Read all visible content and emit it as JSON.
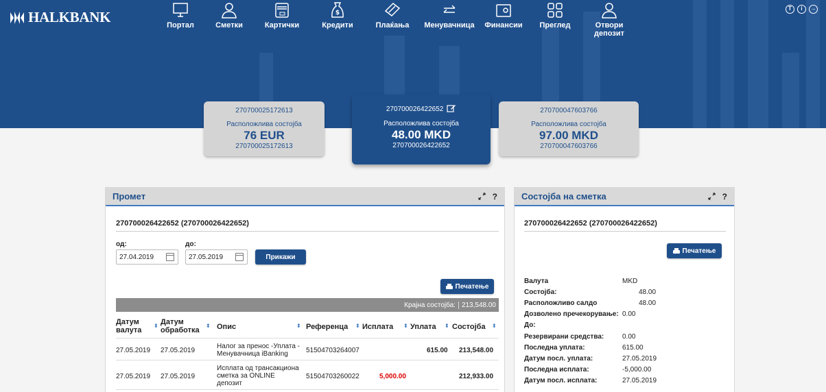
{
  "brand": {
    "name": "HALKBANK"
  },
  "nav": [
    {
      "label": "Портал",
      "icon": "monitor-icon"
    },
    {
      "label": "Сметки",
      "icon": "user-icon"
    },
    {
      "label": "Картички",
      "icon": "card-icon"
    },
    {
      "label": "Кредити",
      "icon": "money-bag-icon"
    },
    {
      "label": "Плаќања",
      "icon": "payment-icon"
    },
    {
      "label": "Менувачница",
      "icon": "exchange-icon"
    },
    {
      "label": "Финансии",
      "icon": "wallet-icon"
    },
    {
      "label": "Преглед",
      "icon": "grid-icon"
    },
    {
      "label": "Отвори",
      "label2": "депозит",
      "icon": "user-deposit-icon"
    }
  ],
  "top_icons": [
    "T",
    "i",
    "→"
  ],
  "accounts": [
    {
      "number": "270700025172613",
      "label": "Расположлива состојба",
      "balance": "76 EUR",
      "number2": "270700025172613"
    },
    {
      "number": "270700026422652",
      "label": "Расположлива состојба",
      "balance": "48.00 MKD",
      "number2": "270700026422652"
    },
    {
      "number": "270700047603766",
      "label": "Расположлива состојба",
      "balance": "97.00 MKD",
      "number2": "270700047603766"
    }
  ],
  "promet": {
    "title": "Промет",
    "help": "?",
    "account": "270700026422652 (270700026422652)",
    "from_label": "од:",
    "from_value": "27.04.2019",
    "to_label": "до:",
    "to_value": "27.05.2019",
    "show_button": "Прикажи",
    "print_button": "Печатење",
    "closing_label": "Крајна состојба:",
    "closing_value": "213,548.00",
    "headers": {
      "value_date_1": "Датум",
      "value_date_2": "валута",
      "proc_date_1": "Датум",
      "proc_date_2": "обработка",
      "desc": "Опис",
      "ref": "Референца",
      "out": "Исплата",
      "in": "Уплата",
      "bal": "Состојба"
    },
    "rows": [
      {
        "value_date": "27.05.2019",
        "proc_date": "27.05.2019",
        "desc1": "Налог за пренос -Уплата -",
        "desc2": "Менувачница iBanking",
        "desc3": "",
        "ref": "51504703264007",
        "out": "",
        "in": "615.00",
        "bal": "213,548.00"
      },
      {
        "value_date": "27.05.2019",
        "proc_date": "27.05.2019",
        "desc1": "Исплата од трансакциона",
        "desc2": "сметка за ONLINE",
        "desc3": "депозит",
        "ref": "51504703260022",
        "out": "5,000.00",
        "in": "",
        "bal": "212,933.00"
      }
    ]
  },
  "status": {
    "title": "Состојба на сметка",
    "help": "?",
    "account": "270700026422652 (270700026422652)",
    "print_button": "Печатење",
    "rows": [
      {
        "k": "Валута",
        "v": "MKD"
      },
      {
        "k": "Состојба:",
        "v": "48.00"
      },
      {
        "k": "Расположливо салдо",
        "v": "48.00"
      },
      {
        "k": "Дозволено пречекорување:",
        "v": "0.00"
      },
      {
        "k": "До:",
        "v": ""
      },
      {
        "k": "Резервирани средства:",
        "v": "0.00"
      },
      {
        "k": "Последна уплата:",
        "v": "615.00"
      },
      {
        "k": "Датум посл. уплата:",
        "v": "27.05.2019"
      },
      {
        "k": "Последна исплата:",
        "v": "-5,000.00"
      },
      {
        "k": "Датум посл. исплата:",
        "v": "27.05.2019"
      }
    ]
  },
  "colors": {
    "primary": "#1f4f8b",
    "accent": "#3f7ac2",
    "negative": "#dd0000"
  }
}
